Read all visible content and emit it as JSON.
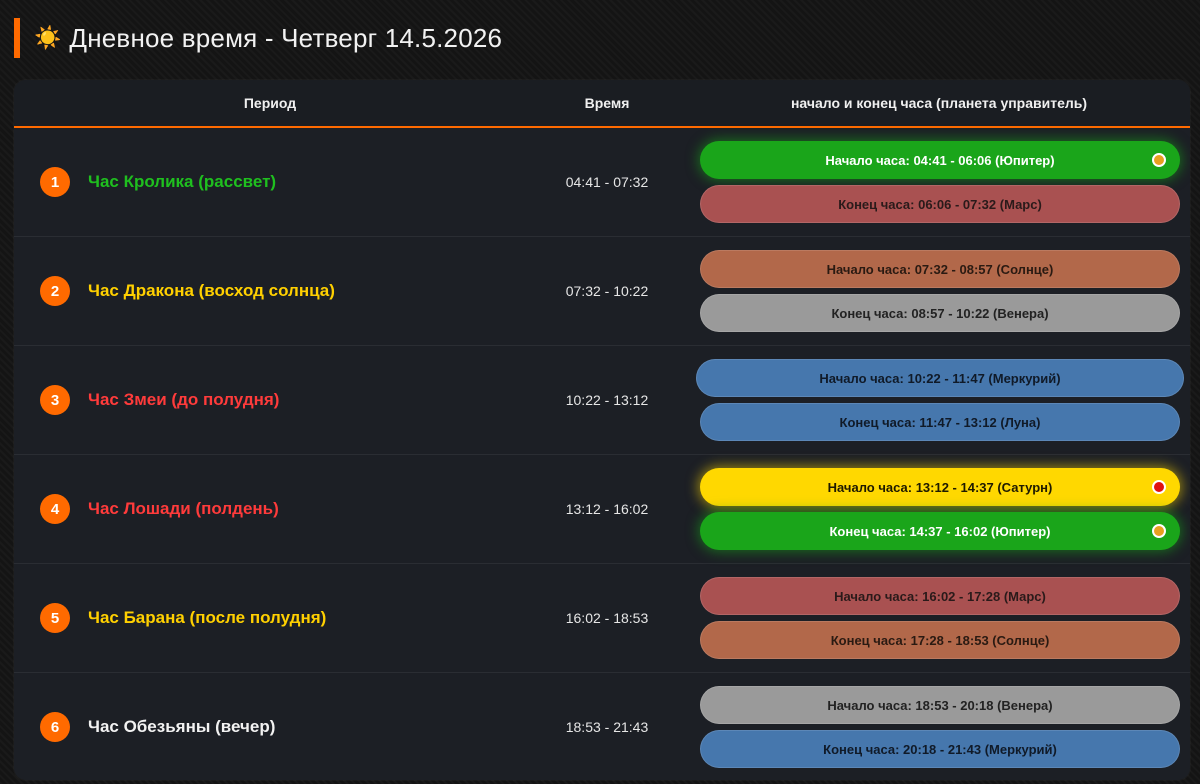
{
  "title": {
    "icon": "sun-icon",
    "text": "Дневное время - Четверг 14.5.2026"
  },
  "header": {
    "period": "Период",
    "time": "Время",
    "hours": "начало и конец часа (планета управитель)"
  },
  "colors": {
    "accent": "#ff6a00",
    "green_text": "#1fbf1f",
    "yellow_text": "#ffd000",
    "red_text": "#ff3b3b",
    "white_text": "#f2f2f2"
  },
  "rows": [
    {
      "num": "1",
      "name": "Час Кролика (рассвет)",
      "name_color": "#1fbf1f",
      "time": "04:41 - 07:32",
      "start": {
        "label": "Начало часа: 04:41 - 06:06 (Юпитер)",
        "bg": "#1aa51a",
        "fg": "#ffffff",
        "dot": "#e8a020",
        "glow": true
      },
      "end": {
        "label": "Конец часа: 06:06 - 07:32 (Марс)",
        "bg": "#a95151",
        "fg": "#2a1a1a",
        "dot": null,
        "glow": false
      }
    },
    {
      "num": "2",
      "name": "Час Дракона (восход солнца)",
      "name_color": "#ffd000",
      "time": "07:32 - 10:22",
      "start": {
        "label": "Начало часа: 07:32 - 08:57 (Солнце)",
        "bg": "#b2684a",
        "fg": "#2a1a12",
        "dot": null,
        "glow": false
      },
      "end": {
        "label": "Конец часа: 08:57 - 10:22 (Венера)",
        "bg": "#9a9a9a",
        "fg": "#222222",
        "dot": null,
        "glow": false
      }
    },
    {
      "num": "3",
      "name": "Час Змеи (до полудня)",
      "name_color": "#ff3b3b",
      "time": "10:22 - 13:12",
      "start": {
        "label": "Начало часа: 10:22 - 11:47 (Меркурий)",
        "bg": "#4677ad",
        "fg": "#101a28",
        "dot": null,
        "glow": false,
        "wide": true
      },
      "end": {
        "label": "Конец часа: 11:47 - 13:12 (Луна)",
        "bg": "#4677ad",
        "fg": "#101a28",
        "dot": null,
        "glow": false
      }
    },
    {
      "num": "4",
      "name": "Час Лошади (полдень)",
      "name_color": "#ff3b3b",
      "time": "13:12 - 16:02",
      "start": {
        "label": "Начало часа: 13:12 - 14:37 (Сатурн)",
        "bg": "#ffd800",
        "fg": "#1e1a00",
        "dot": "#e01010",
        "glow": true,
        "glow_color": "rgba(255,216,0,0.55)"
      },
      "end": {
        "label": "Конец часа: 14:37 - 16:02 (Юпитер)",
        "bg": "#1aa51a",
        "fg": "#ffffff",
        "dot": "#e8a020",
        "glow": true
      }
    },
    {
      "num": "5",
      "name": "Час Барана (после полудня)",
      "name_color": "#ffd000",
      "time": "16:02 - 18:53",
      "start": {
        "label": "Начало часа: 16:02 - 17:28 (Марс)",
        "bg": "#a95151",
        "fg": "#2a1a1a",
        "dot": null,
        "glow": false
      },
      "end": {
        "label": "Конец часа: 17:28 - 18:53 (Солнце)",
        "bg": "#b2684a",
        "fg": "#2a1a12",
        "dot": null,
        "glow": false
      }
    },
    {
      "num": "6",
      "name": "Час Обезьяны (вечер)",
      "name_color": "#f2f2f2",
      "time": "18:53 - 21:43",
      "start": {
        "label": "Начало часа: 18:53 - 20:18 (Венера)",
        "bg": "#9a9a9a",
        "fg": "#222222",
        "dot": null,
        "glow": false
      },
      "end": {
        "label": "Конец часа: 20:18 - 21:43 (Меркурий)",
        "bg": "#4677ad",
        "fg": "#101a28",
        "dot": null,
        "glow": false
      }
    }
  ]
}
